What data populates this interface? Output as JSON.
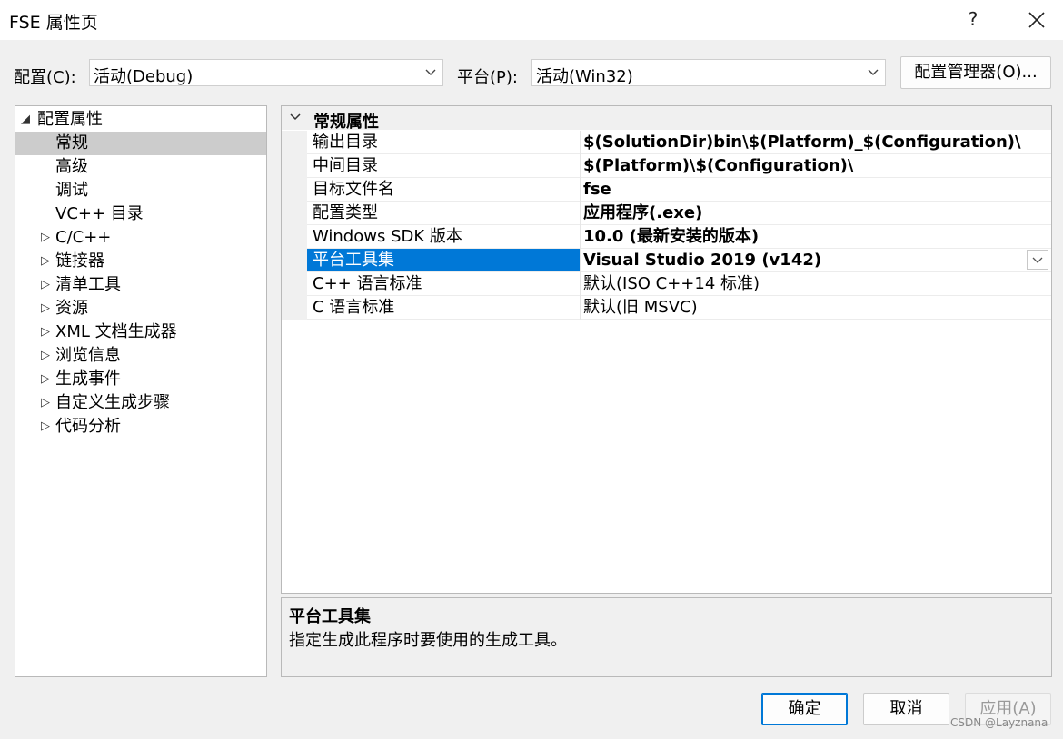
{
  "window": {
    "title": "FSE 属性页",
    "help": "?"
  },
  "toolbar": {
    "config_label": "配置(C):",
    "config_value": "活动(Debug)",
    "platform_label": "平台(P):",
    "platform_value": "活动(Win32)",
    "config_manager_button": "配置管理器(O)..."
  },
  "tree": {
    "items": [
      {
        "label": "配置属性"
      },
      {
        "label": "常规"
      },
      {
        "label": "高级"
      },
      {
        "label": "调试"
      },
      {
        "label": "VC++ 目录"
      },
      {
        "label": "C/C++"
      },
      {
        "label": "链接器"
      },
      {
        "label": "清单工具"
      },
      {
        "label": "资源"
      },
      {
        "label": "XML 文档生成器"
      },
      {
        "label": "浏览信息"
      },
      {
        "label": "生成事件"
      },
      {
        "label": "自定义生成步骤"
      },
      {
        "label": "代码分析"
      }
    ]
  },
  "grid": {
    "category": "常规属性",
    "rows": [
      {
        "name": "输出目录",
        "value": "$(SolutionDir)bin\\$(Platform)_$(Configuration)\\"
      },
      {
        "name": "中间目录",
        "value": "$(Platform)\\$(Configuration)\\"
      },
      {
        "name": "目标文件名",
        "value": "fse"
      },
      {
        "name": "配置类型",
        "value": "应用程序(.exe)"
      },
      {
        "name": "Windows SDK 版本",
        "value": "10.0 (最新安装的版本)"
      },
      {
        "name": "平台工具集",
        "value": "Visual Studio 2019 (v142)"
      },
      {
        "name": "C++ 语言标准",
        "value": "默认(ISO C++14 标准)"
      },
      {
        "name": "C 语言标准",
        "value": "默认(旧 MSVC)"
      }
    ]
  },
  "description": {
    "title": "平台工具集",
    "text": "指定生成此程序时要使用的生成工具。"
  },
  "buttons": {
    "ok": "确定",
    "cancel": "取消",
    "apply": "应用(A)"
  },
  "watermark": "CSDN @Layznana",
  "colors": {
    "selection": "#0078d7",
    "tree_selection": "#cccccc",
    "background": "#f0f0f0"
  }
}
